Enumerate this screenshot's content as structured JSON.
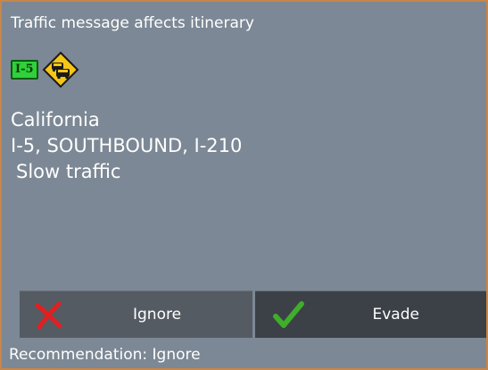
{
  "dialog": {
    "title": "Traffic message affects itinerary",
    "road_badge": "I-5",
    "warning_icon": "slow-traffic-warning-icon",
    "region": "California",
    "location": "I-5, SOUTHBOUND, I-210",
    "event": "Slow traffic",
    "recommendation": "Recommendation: Ignore"
  },
  "buttons": {
    "ignore_label": "Ignore",
    "ignore_icon": "red-x-icon",
    "evade_label": "Evade",
    "evade_icon": "green-check-icon"
  },
  "colors": {
    "background": "#7c8895",
    "border": "#c8864a",
    "road_badge": "#2fd13a",
    "warning_sign": "#f5c518",
    "ignore_icon": "#e02020",
    "evade_icon": "#3fae2a"
  }
}
